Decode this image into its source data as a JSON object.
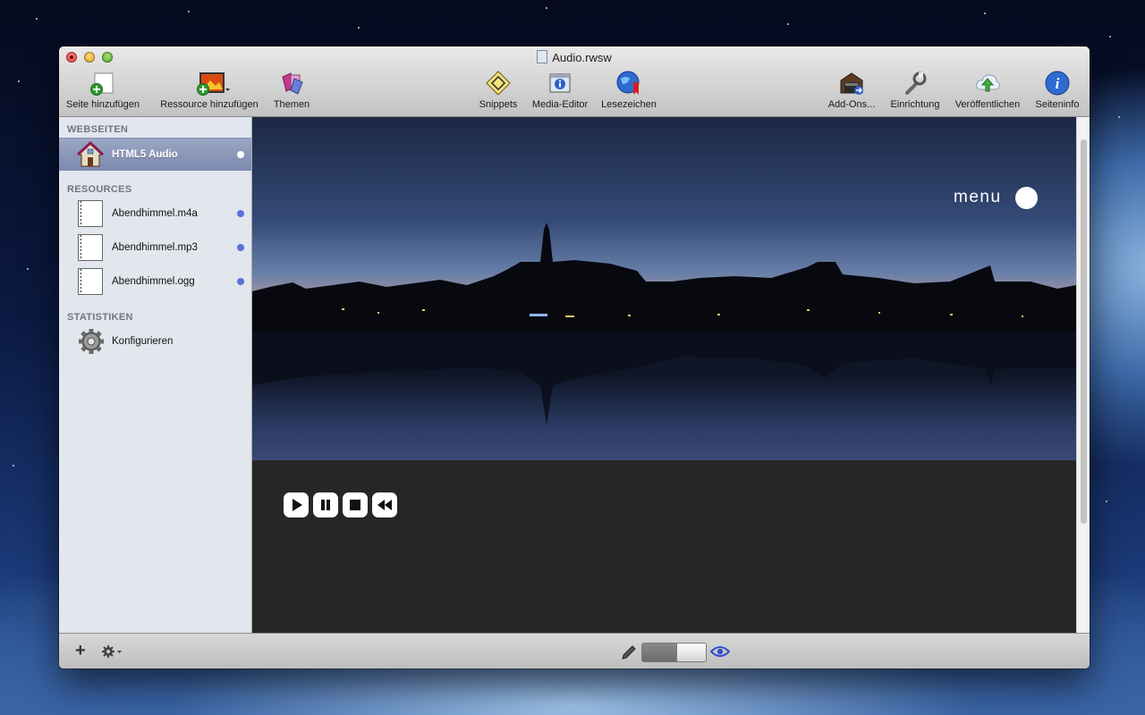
{
  "window": {
    "title": "Audio.rwsw"
  },
  "toolbar": {
    "add_page": "Seite hinzufügen",
    "add_resource": "Ressource hinzufügen",
    "themes": "Themen",
    "snippets": "Snippets",
    "media_editor": "Media-Editor",
    "bookmarks": "Lesezeichen",
    "addons": "Add-Ons...",
    "setup": "Einrichtung",
    "publish": "Veröffentlichen",
    "page_info": "Seiteninfo"
  },
  "sidebar": {
    "webpages_header": "WEBSEITEN",
    "pages": [
      {
        "label": "HTML5 Audio"
      }
    ],
    "resources_header": "RESOURCES",
    "resources": [
      {
        "label": "Abendhimmel.m4a"
      },
      {
        "label": "Abendhimmel.mp3"
      },
      {
        "label": "Abendhimmel.ogg"
      }
    ],
    "stats_header": "STATISTIKEN",
    "stats": [
      {
        "label": "Konfigurieren"
      }
    ]
  },
  "preview": {
    "menu_label": "menu",
    "controls": [
      "play-icon",
      "pause-icon",
      "stop-icon",
      "rewind-icon"
    ]
  },
  "bottombar": {
    "add_symbol": "+",
    "mode_toggle": "preview"
  },
  "colors": {
    "selection": "#8190b6",
    "status_dot": "#5b6fd8",
    "preview_bg": "#262626"
  }
}
